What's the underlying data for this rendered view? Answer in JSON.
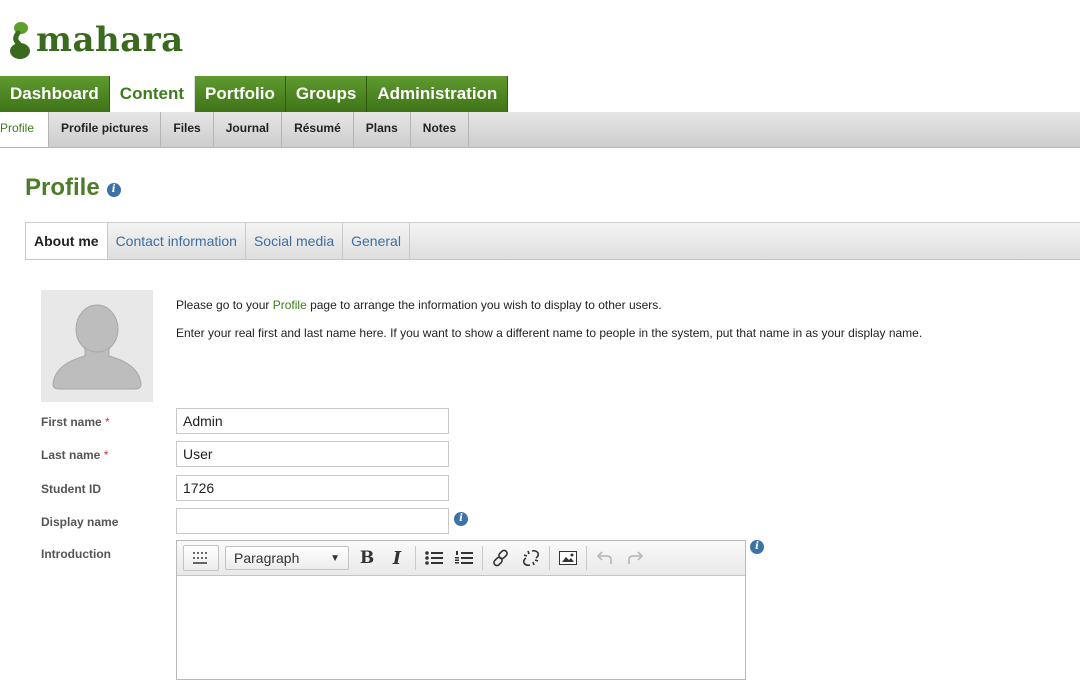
{
  "app": {
    "logo_text": "mahara"
  },
  "main_nav": {
    "items": [
      {
        "label": "Dashboard"
      },
      {
        "label": "Content"
      },
      {
        "label": "Portfolio"
      },
      {
        "label": "Groups"
      },
      {
        "label": "Administration"
      }
    ],
    "active": "Content"
  },
  "sub_nav": {
    "items": [
      {
        "label": "Profile"
      },
      {
        "label": "Profile pictures"
      },
      {
        "label": "Files"
      },
      {
        "label": "Journal"
      },
      {
        "label": "Résumé"
      },
      {
        "label": "Plans"
      },
      {
        "label": "Notes"
      }
    ],
    "active": "Profile"
  },
  "page": {
    "title": "Profile"
  },
  "tabs": {
    "items": [
      {
        "label": "About me"
      },
      {
        "label": "Contact information"
      },
      {
        "label": "Social media"
      },
      {
        "label": "General"
      }
    ],
    "active": "About me"
  },
  "intro": {
    "line1_before": "Please go to your ",
    "line1_link": "Profile",
    "line1_after": " page to arrange the information you wish to display to other users.",
    "line2": "Enter your real first and last name here. If you want to show a different name to people in the system, put that name in as your display name."
  },
  "form": {
    "required_marker": "*",
    "first_name": {
      "label": "First name",
      "value": "Admin"
    },
    "last_name": {
      "label": "Last name",
      "value": "User"
    },
    "student_id": {
      "label": "Student ID",
      "value": "1726"
    },
    "display_name": {
      "label": "Display name",
      "value": ""
    },
    "introduction": {
      "label": "Introduction"
    }
  },
  "editor": {
    "format_value": "Paragraph",
    "bold_glyph": "B",
    "italic_glyph": "I",
    "icons": [
      "toolbar-toggle-icon",
      "bullet-list-icon",
      "numbered-list-icon",
      "link-icon",
      "unlink-icon",
      "image-icon",
      "undo-icon",
      "redo-icon"
    ]
  },
  "colors": {
    "brand_green": "#3c7d1a",
    "nav_green": "#4e8a25",
    "link_blue": "#3b6fa0",
    "info_blue": "#3b73a6",
    "required_red": "#cc3333"
  }
}
